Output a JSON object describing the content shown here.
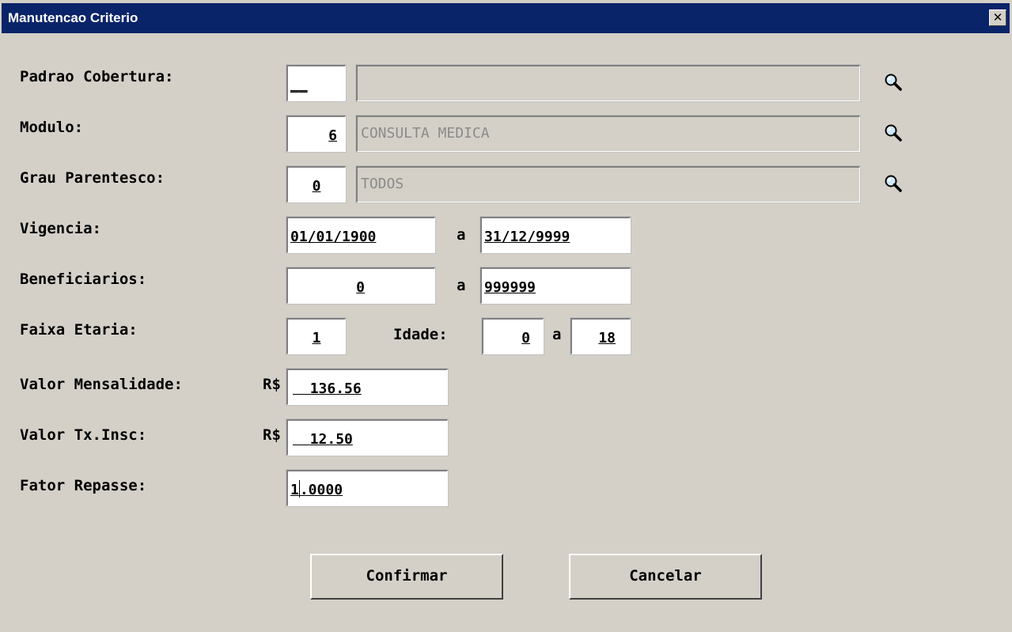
{
  "window": {
    "title": "Manutencao Criterio",
    "close_label": "✕"
  },
  "form": {
    "padrao_cobertura": {
      "label": "Padrao Cobertura:",
      "code": "__",
      "description": ""
    },
    "modulo": {
      "label": "Modulo:",
      "code": "6",
      "description": "CONSULTA MEDICA"
    },
    "grau_parentesco": {
      "label": "Grau Parentesco:",
      "code": "0",
      "description": "TODOS"
    },
    "vigencia": {
      "label": "Vigencia:",
      "from": "01/01/1900",
      "sep": "a",
      "to": "31/12/9999"
    },
    "beneficiarios": {
      "label": "Beneficiarios:",
      "from": "0",
      "sep": "a",
      "to": "999999"
    },
    "faixa_etaria": {
      "label": "Faixa Etaria:",
      "value": "1",
      "idade_label": "Idade:",
      "idade_from": "0",
      "sep": "a",
      "idade_to": "18"
    },
    "valor_mensalidade": {
      "label": "Valor Mensalidade:",
      "currency": "R$",
      "value": "136.56"
    },
    "valor_tx_insc": {
      "label": "Valor Tx.Insc:",
      "currency": "R$",
      "value": "12.50"
    },
    "fator_repasse": {
      "label": "Fator Repasse:",
      "value_before_cursor": "1",
      "value_after_cursor": ".0000"
    }
  },
  "buttons": {
    "confirm": "Confirmar",
    "cancel": "Cancelar"
  },
  "icons": {
    "lookup": "magnifier-icon",
    "close": "close-icon"
  },
  "colors": {
    "titlebar": "#0a246a",
    "window_bg": "#d4d0c8",
    "readonly_text": "#8a8a8a"
  }
}
